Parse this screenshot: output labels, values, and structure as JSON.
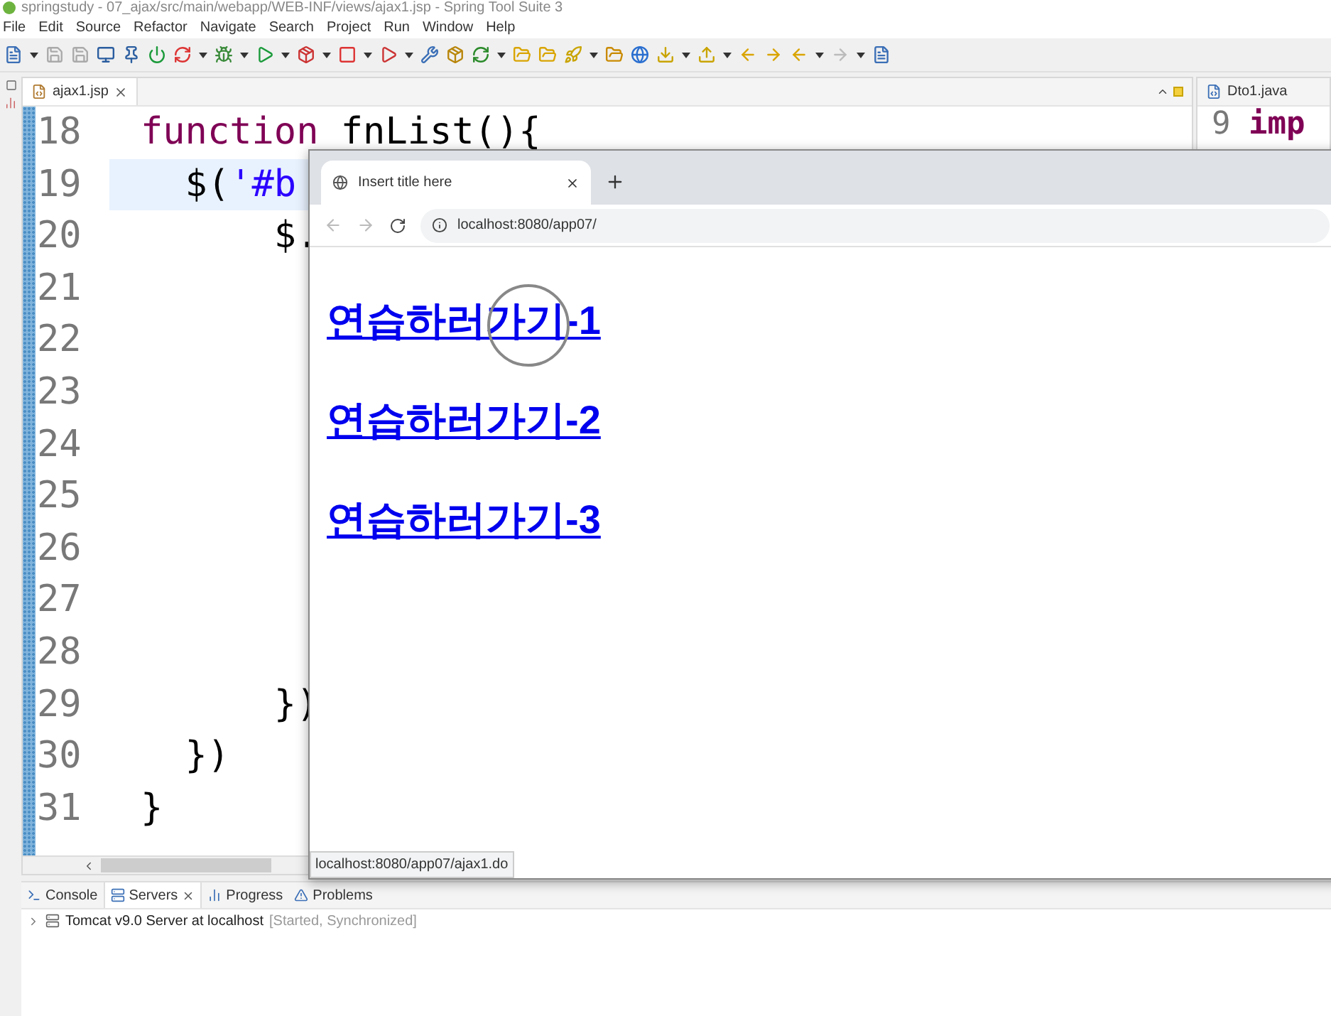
{
  "window": {
    "title": "springstudy - 07_ajax/src/main/webapp/WEB-INF/views/ajax1.jsp - Spring Tool Suite 3"
  },
  "menu": [
    "File",
    "Edit",
    "Source",
    "Refactor",
    "Navigate",
    "Search",
    "Project",
    "Run",
    "Window",
    "Help"
  ],
  "editor": {
    "tab": {
      "label": "ajax1.jsp"
    },
    "lines": [
      {
        "number": "18",
        "current": false,
        "tokens": [
          {
            "text": "function",
            "kind": "keyword"
          },
          {
            "text": " fnList(){",
            "kind": "plain"
          }
        ]
      },
      {
        "number": "19",
        "current": true,
        "tokens": [
          {
            "text": "  $(",
            "kind": "plain"
          },
          {
            "text": "'#b",
            "kind": "string"
          }
        ]
      },
      {
        "number": "20",
        "current": false,
        "tokens": [
          {
            "text": "      $.",
            "kind": "plain"
          }
        ]
      },
      {
        "number": "21",
        "current": false
      },
      {
        "number": "22",
        "current": false
      },
      {
        "number": "23",
        "current": false
      },
      {
        "number": "24",
        "current": false
      },
      {
        "number": "25",
        "current": false
      },
      {
        "number": "26",
        "current": false
      },
      {
        "number": "27",
        "current": false
      },
      {
        "number": "28",
        "current": false
      },
      {
        "number": "29",
        "current": false,
        "tokens": [
          {
            "text": "      })",
            "kind": "plain"
          }
        ]
      },
      {
        "number": "30",
        "current": false,
        "tokens": [
          {
            "text": "  })",
            "kind": "plain"
          }
        ]
      },
      {
        "number": "31",
        "current": false,
        "tokens": [
          {
            "text": "}",
            "kind": "plain"
          }
        ]
      }
    ]
  },
  "side_editor": {
    "tab": {
      "label": "Dto1.java"
    },
    "line": {
      "number": "9",
      "text": "imp"
    }
  },
  "browser": {
    "tab": {
      "title": "Insert title here"
    },
    "url": "localhost:8080/app07/",
    "links": [
      "연습하러가기-1",
      "연습하러가기-2",
      "연습하러가기-3"
    ],
    "status": "localhost:8080/app07/ajax1.do"
  },
  "bottom_panel": {
    "tabs": [
      {
        "label": "Console",
        "selected": false
      },
      {
        "label": "Servers",
        "selected": true
      },
      {
        "label": "Progress",
        "selected": false
      },
      {
        "label": "Problems",
        "selected": false
      }
    ],
    "servers": [
      {
        "name": "Tomcat v9.0 Server at localhost",
        "state": "[Started, Synchronized]",
        "expanded": false
      }
    ]
  }
}
